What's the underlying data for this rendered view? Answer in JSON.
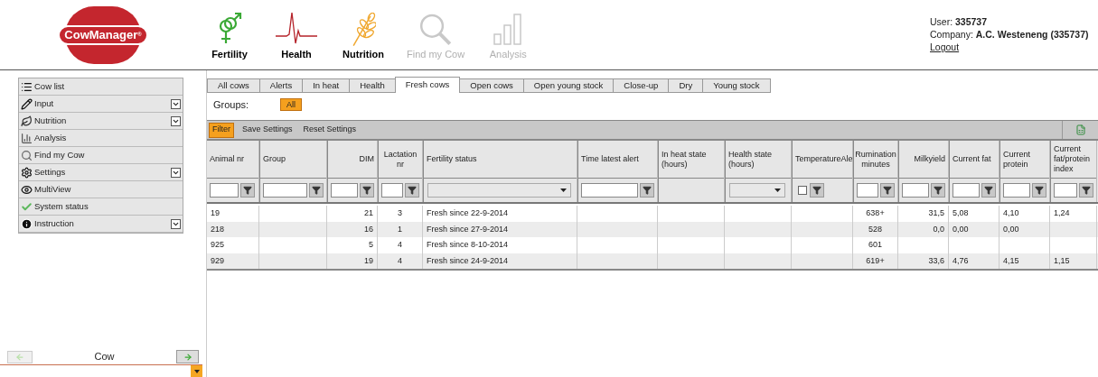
{
  "logo": {
    "text": "CowManager",
    "mark": "®"
  },
  "nav": [
    {
      "kind": "fertility",
      "label": "Fertility",
      "disabled": false
    },
    {
      "kind": "health",
      "label": "Health",
      "disabled": false
    },
    {
      "kind": "nutrition",
      "label": "Nutrition",
      "disabled": false
    },
    {
      "kind": "search",
      "label": "Find my Cow",
      "disabled": true
    },
    {
      "kind": "analysis",
      "label": "Analysis",
      "disabled": true
    }
  ],
  "user": {
    "user_label": "User:",
    "user": "335737",
    "company_label": "Company:",
    "company": "A.C. Westeneng (335737)",
    "logout": "Logout"
  },
  "menu": [
    {
      "kind": "list",
      "label": "Cow list",
      "expandable": false
    },
    {
      "kind": "pencil",
      "label": "Input",
      "expandable": true
    },
    {
      "kind": "leaf",
      "label": "Nutrition",
      "expandable": true
    },
    {
      "kind": "bars",
      "label": "Analysis",
      "expandable": false
    },
    {
      "kind": "search",
      "label": "Find my Cow",
      "expandable": false
    },
    {
      "kind": "gear",
      "label": "Settings",
      "expandable": true
    },
    {
      "kind": "eye",
      "label": "MultiView",
      "expandable": false
    },
    {
      "kind": "check",
      "label": "System status",
      "expandable": false
    },
    {
      "kind": "info",
      "label": "Instruction",
      "expandable": true
    }
  ],
  "cow_nav": {
    "prev_disabled": true,
    "label": "Cow"
  },
  "tabs": [
    {
      "label": "All cows",
      "selected": false
    },
    {
      "label": "Alerts",
      "selected": false
    },
    {
      "label": "In heat",
      "selected": false
    },
    {
      "label": "Health",
      "selected": false
    },
    {
      "label": "Fresh cows",
      "selected": true
    },
    {
      "label": "Open cows",
      "selected": false
    },
    {
      "label": "Open young stock",
      "selected": false
    },
    {
      "label": "Close-up",
      "selected": false
    },
    {
      "label": "Dry",
      "selected": false
    },
    {
      "label": "Young stock",
      "selected": false
    }
  ],
  "groups": {
    "label": "Groups:",
    "items": [
      {
        "label": "All",
        "selected": true
      }
    ]
  },
  "toolbar": [
    {
      "label": "Filter",
      "selected": true
    },
    {
      "label": "Save Settings",
      "selected": false
    },
    {
      "label": "Reset Settings",
      "selected": false
    }
  ],
  "table": {
    "columns": [
      {
        "label": "Animal nr",
        "kind": "text"
      },
      {
        "label": "Group",
        "kind": "text"
      },
      {
        "label": "DIM",
        "kind": "text"
      },
      {
        "label": "Lactation nr",
        "kind": "text"
      },
      {
        "label": "Fertility status",
        "kind": "select"
      },
      {
        "label": "Time latest alert",
        "kind": "text"
      },
      {
        "label": "In heat state (hours)",
        "kind": "none"
      },
      {
        "label": "Health state (hours)",
        "kind": "select"
      },
      {
        "label": "TemperatureAle",
        "kind": "checkbox",
        "checked": false
      },
      {
        "label": "Rumination minutes",
        "kind": "text"
      },
      {
        "label": "Milkyield",
        "kind": "text"
      },
      {
        "label": "Current fat",
        "kind": "text"
      },
      {
        "label": "Current protein",
        "kind": "text"
      },
      {
        "label": "Current fat/protein index",
        "kind": "text"
      }
    ],
    "rows": [
      [
        "19",
        "",
        "21",
        "3",
        "Fresh since 22-9-2014",
        "",
        "",
        "",
        "",
        "638+",
        "31,5",
        "5,08",
        "4,10",
        "1,24"
      ],
      [
        "218",
        "",
        "16",
        "1",
        "Fresh since 27-9-2014",
        "",
        "",
        "",
        "",
        "528",
        "0,0",
        "0,00",
        "0,00",
        ""
      ],
      [
        "925",
        "",
        "5",
        "4",
        "Fresh since 8-10-2014",
        "",
        "",
        "",
        "",
        "601",
        "",
        "",
        "",
        ""
      ],
      [
        "929",
        "",
        "19",
        "4",
        "Fresh since 24-9-2014",
        "",
        "",
        "",
        "",
        "619+",
        "33,6",
        "4,76",
        "4,15",
        "1,15"
      ]
    ]
  }
}
